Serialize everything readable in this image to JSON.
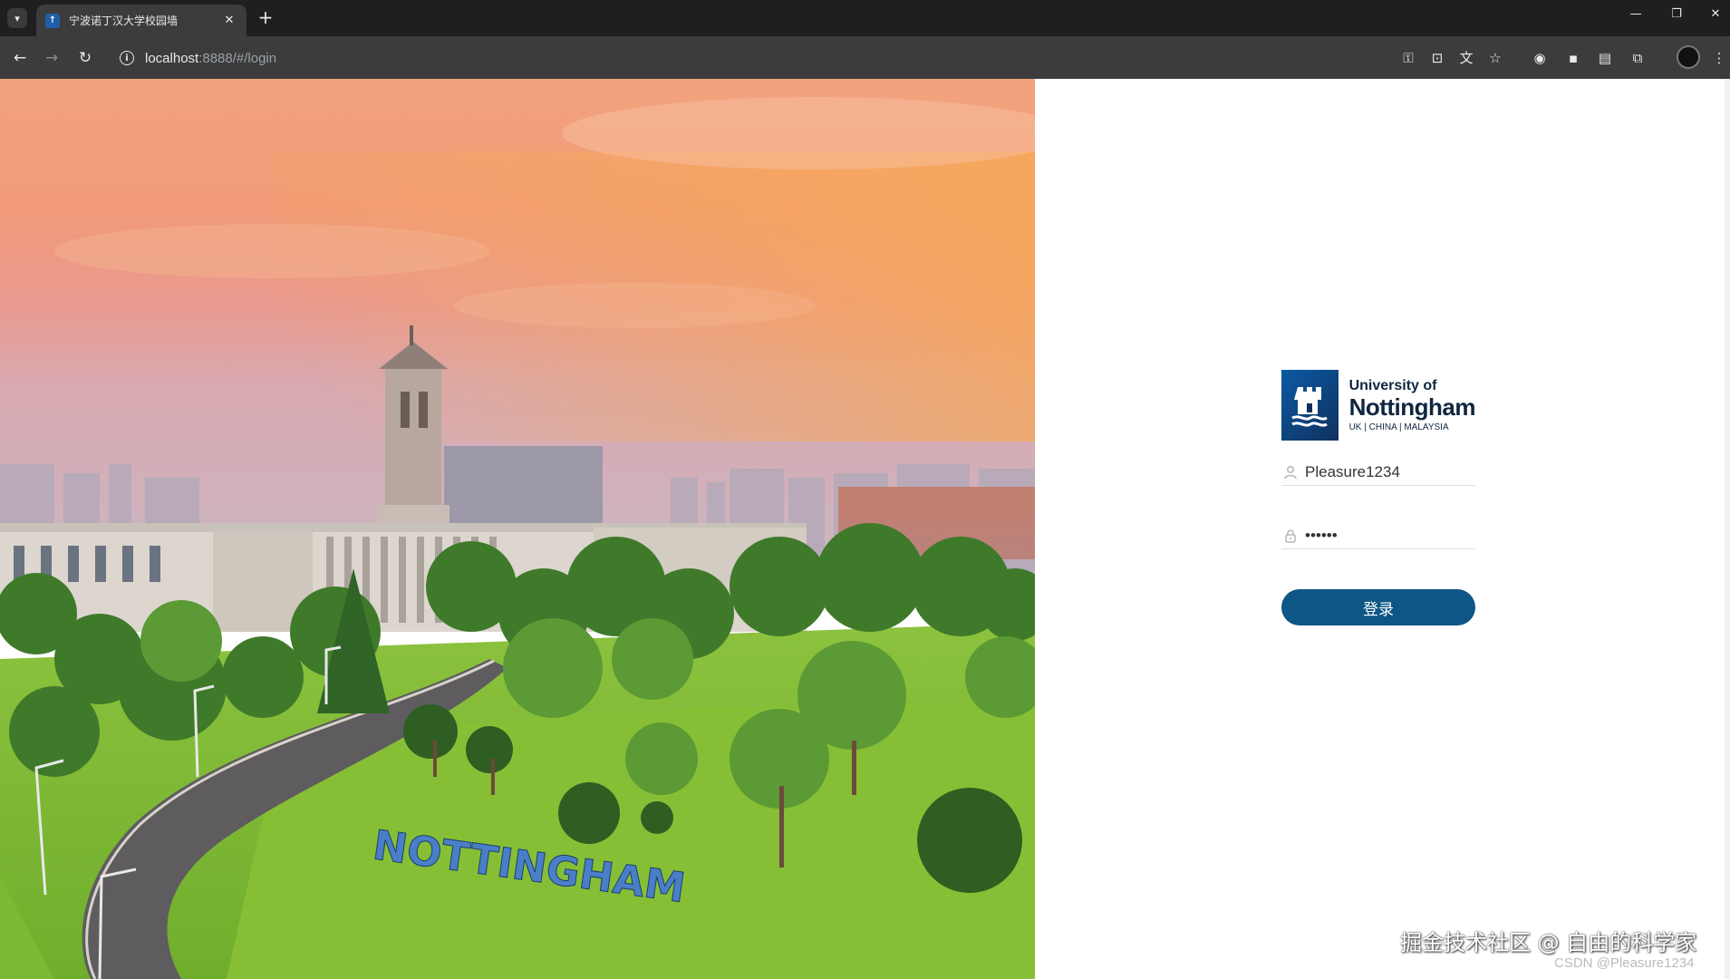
{
  "browser": {
    "tab_title": "宁波诺丁汉大学校园墙",
    "url_host": "localhost",
    "url_rest": ":8888/#/login",
    "icons": [
      "tab-list-icon",
      "close-icon",
      "plus-icon",
      "back-icon",
      "forward-icon",
      "reload-icon",
      "info-icon",
      "key-icon",
      "install-icon",
      "translate-icon",
      "star-icon",
      "extension-icon",
      "profile-avatar",
      "menu-icon"
    ]
  },
  "photo": {
    "sign_text": "NOTTINGHAM"
  },
  "logo": {
    "line1": "University of",
    "line2": "Nottingham",
    "line3": "UK | CHINA | MALAYSIA"
  },
  "form": {
    "username_value": "Pleasure1234",
    "password_value": "123456",
    "submit_label": "登录"
  },
  "watermark": {
    "line1": "掘金技术社区 @ 自由的科学家",
    "line2": "CSDN @Pleasure1234"
  },
  "colors": {
    "button": "#0d5685",
    "brand": "#10315e"
  }
}
